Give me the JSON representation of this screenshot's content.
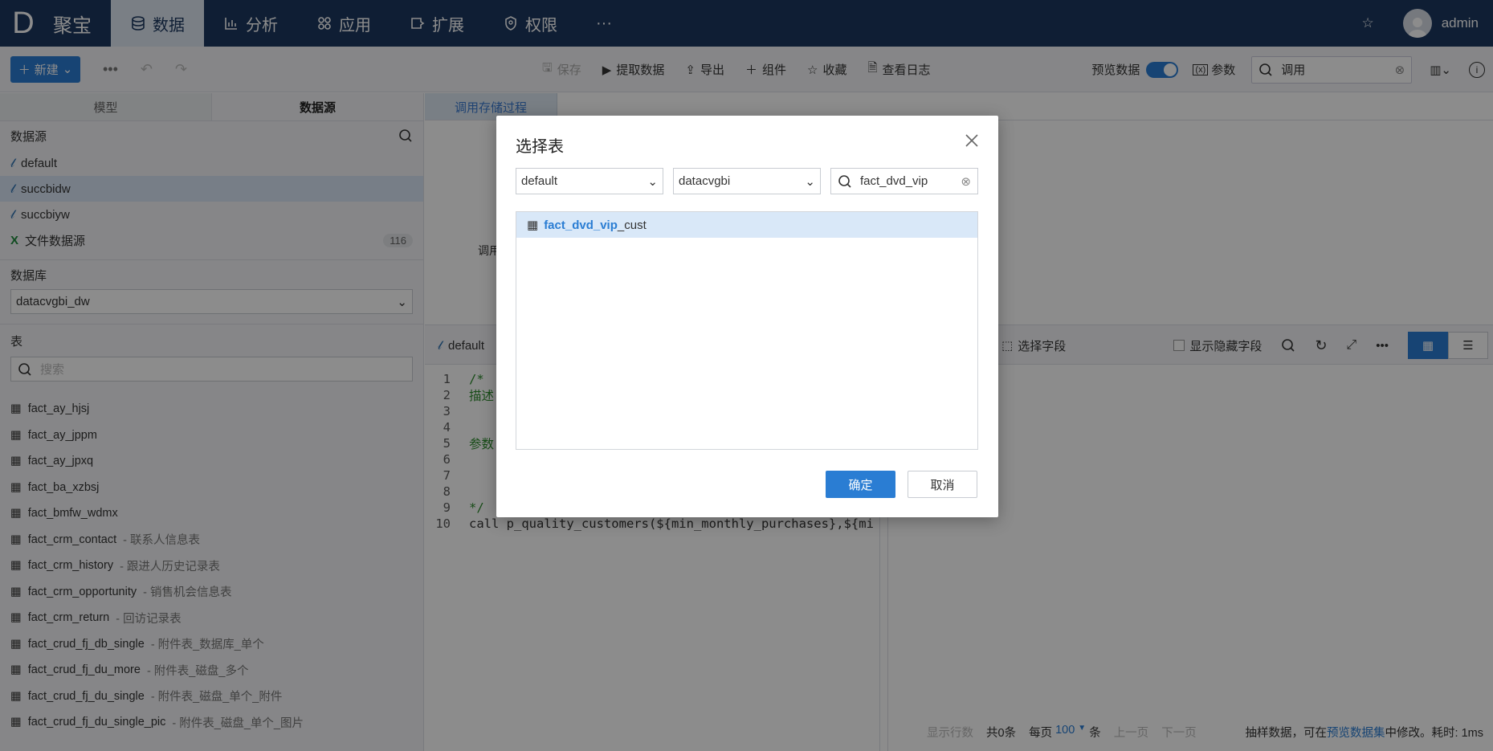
{
  "header": {
    "logo": "D",
    "brand": "聚宝",
    "nav": [
      {
        "label": "数据",
        "icon": "database-icon",
        "active": true
      },
      {
        "label": "分析",
        "icon": "bar-chart-icon"
      },
      {
        "label": "应用",
        "icon": "apps-icon"
      },
      {
        "label": "扩展",
        "icon": "extension-icon"
      },
      {
        "label": "权限",
        "icon": "shield-icon"
      },
      {
        "label": "···",
        "icon": "more-icon"
      }
    ],
    "user": "admin"
  },
  "toolbar": {
    "new_label": "新建",
    "save_label": "保存",
    "extract_label": "提取数据",
    "export_label": "导出",
    "component_label": "组件",
    "favorite_label": "收藏",
    "log_label": "查看日志",
    "preview_label": "预览数据",
    "params_label": "参数",
    "search_value": "调用"
  },
  "left": {
    "tabs": [
      "模型",
      "数据源"
    ],
    "datasource_title": "数据源",
    "datasources": [
      {
        "name": "default"
      },
      {
        "name": "succbidw"
      },
      {
        "name": "succbiyw"
      },
      {
        "name": "文件数据源",
        "count": "116"
      }
    ],
    "db_title": "数据库",
    "db_value": "datacvgbi_dw",
    "table_title": "表",
    "search_placeholder": "搜索",
    "tables": [
      {
        "name": "fact_ay_hjsj",
        "desc": ""
      },
      {
        "name": "fact_ay_jppm",
        "desc": ""
      },
      {
        "name": "fact_ay_jpxq",
        "desc": ""
      },
      {
        "name": "fact_ba_xzbsj",
        "desc": ""
      },
      {
        "name": "fact_bmfw_wdmx",
        "desc": ""
      },
      {
        "name": "fact_crm_contact",
        "desc": " - 联系人信息表"
      },
      {
        "name": "fact_crm_history",
        "desc": " - 跟进人历史记录表"
      },
      {
        "name": "fact_crm_opportunity",
        "desc": " - 销售机会信息表"
      },
      {
        "name": "fact_crm_return",
        "desc": " - 回访记录表"
      },
      {
        "name": "fact_crud_fj_db_single",
        "desc": " - 附件表_数据库_单个"
      },
      {
        "name": "fact_crud_fj_du_more",
        "desc": " - 附件表_磁盘_多个"
      },
      {
        "name": "fact_crud_fj_du_single",
        "desc": " - 附件表_磁盘_单个_附件"
      },
      {
        "name": "fact_crud_fj_du_single_pic",
        "desc": " - 附件表_磁盘_单个_图片"
      }
    ]
  },
  "main": {
    "tab_label": "调用存储过程",
    "call_label": "调用",
    "editor_source": "default",
    "select_fields_label": "选择字段",
    "show_hidden_label": "显示隐藏字段",
    "code_lines": [
      {
        "n": "1",
        "text": "/*",
        "cls": "comment"
      },
      {
        "n": "2",
        "text": "描述",
        "cls": "comment"
      },
      {
        "n": "3",
        "text": "",
        "cls": ""
      },
      {
        "n": "4",
        "text": "",
        "cls": ""
      },
      {
        "n": "5",
        "text": "参数",
        "cls": "comment"
      },
      {
        "n": "6",
        "text": "",
        "cls": ""
      },
      {
        "n": "7",
        "text": "",
        "cls": ""
      },
      {
        "n": "8",
        "text": "",
        "cls": ""
      },
      {
        "n": "9",
        "text": "*/",
        "cls": "comment"
      },
      {
        "n": "10",
        "text": "call p_quality_customers(${min_monthly_purchases},${mi",
        "cls": ""
      }
    ],
    "footer": {
      "rows_label": "显示行数",
      "total": "共0条",
      "per_page": "每页",
      "page_size": "100",
      "unit": "条",
      "prev": "上一页",
      "next": "下一页",
      "note_prefix": "抽样数据，可在",
      "note_link": "预览数据集",
      "note_suffix": "中修改。耗时: 1ms"
    }
  },
  "modal": {
    "title": "选择表",
    "source_value": "default",
    "db_value": "datacvgbi",
    "search_value": "fact_dvd_vip",
    "result_highlight": "fact_dvd_vip",
    "result_rest": "_cust",
    "ok_label": "确定",
    "cancel_label": "取消"
  }
}
